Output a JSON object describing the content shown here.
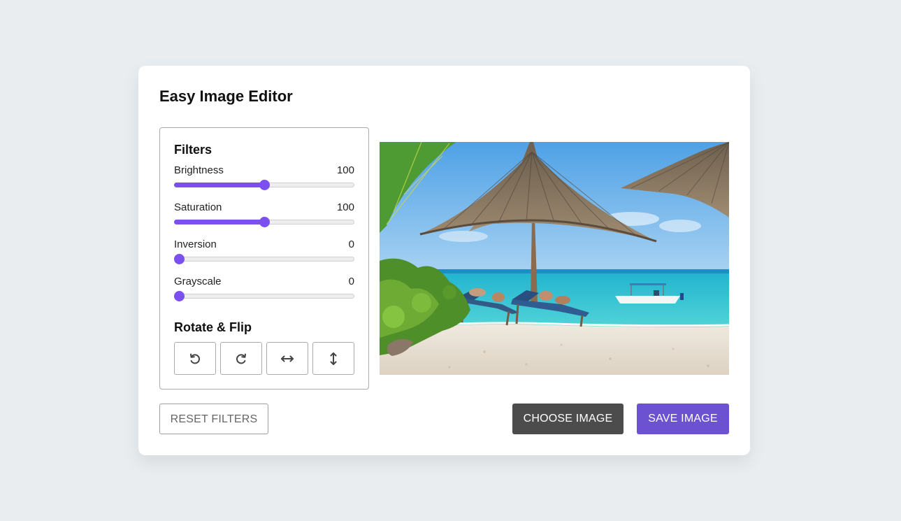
{
  "app": {
    "title": "Easy Image Editor"
  },
  "filters": {
    "heading": "Filters",
    "items": [
      {
        "label": "Brightness",
        "value": "100",
        "fraction": 0.5
      },
      {
        "label": "Saturation",
        "value": "100",
        "fraction": 0.5
      },
      {
        "label": "Inversion",
        "value": "0",
        "fraction": 0
      },
      {
        "label": "Grayscale",
        "value": "0",
        "fraction": 0
      }
    ]
  },
  "rotate": {
    "heading": "Rotate & Flip",
    "buttons": [
      {
        "icon": "rotate-left-icon"
      },
      {
        "icon": "rotate-right-icon"
      },
      {
        "icon": "flip-horizontal-icon"
      },
      {
        "icon": "flip-vertical-icon"
      }
    ]
  },
  "preview": {
    "subject": "beach-umbrella-photo"
  },
  "actions": {
    "reset_label": "RESET FILTERS",
    "choose_label": "CHOOSE IMAGE",
    "save_label": "SAVE IMAGE"
  },
  "colors": {
    "accent": "#7b50ee",
    "save_button": "#6c52d0",
    "choose_button": "#4c4c4c",
    "background": "#e9edf0"
  }
}
